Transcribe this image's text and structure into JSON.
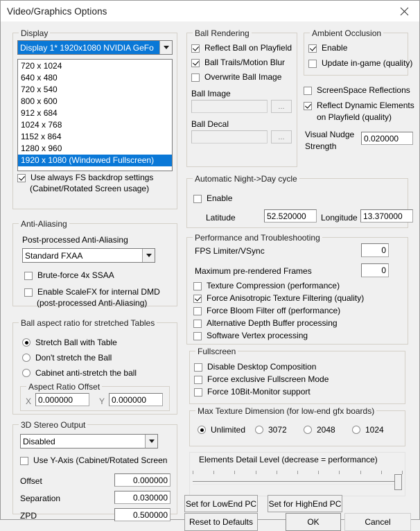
{
  "window": {
    "title": "Video/Graphics Options",
    "close_icon": "close-icon"
  },
  "display": {
    "caption": "Display",
    "combo_value": "Display 1* 1920x1080 NVIDIA GeFo",
    "resolutions": [
      "720 x 1024",
      "640 x 480",
      "720 x 540",
      "800 x 600",
      "912 x 684",
      "1024 x 768",
      "1152 x 864",
      "1280 x 960",
      "1920 x 1080 (Windowed Fullscreen)"
    ],
    "selected_resolution_index": 8,
    "fs_backdrop": {
      "label_line1": "Use always FS backdrop settings",
      "label_line2": "(Cabinet/Rotated Screen usage)",
      "checked": true
    }
  },
  "anti_aliasing": {
    "caption": "Anti-Aliasing",
    "post_label": "Post-processed Anti-Aliasing",
    "post_value": "Standard FXAA",
    "brute_force": {
      "label": "Brute-force 4x SSAA",
      "checked": false
    },
    "scalefx": {
      "label_line1": "Enable ScaleFX for internal DMD",
      "label_line2": "(post-processed Anti-Aliasing)",
      "checked": false
    }
  },
  "ball_aspect": {
    "caption": "Ball aspect ratio for stretched Tables",
    "options": [
      "Stretch Ball with Table",
      "Don't stretch the Ball",
      "Cabinet anti-stretch the ball"
    ],
    "selected_index": 0,
    "offset_caption": "Aspect Ratio Offset",
    "x_label": "X",
    "x_value": "0.000000",
    "y_label": "Y",
    "y_value": "0.000000"
  },
  "stereo": {
    "caption": "3D Stereo Output",
    "mode_value": "Disabled",
    "y_axis": {
      "label": "Use Y-Axis (Cabinet/Rotated Screen",
      "checked": false
    },
    "rows": [
      {
        "label": "Offset",
        "value": "0.000000"
      },
      {
        "label": "Separation",
        "value": "0.030000"
      },
      {
        "label": "ZPD",
        "value": "0.500000"
      }
    ]
  },
  "ball_rendering": {
    "caption": "Ball Rendering",
    "checks": [
      {
        "label": "Reflect Ball on Playfield",
        "checked": true
      },
      {
        "label": "Ball Trails/Motion Blur",
        "checked": true
      },
      {
        "label": "Overwrite Ball Image",
        "checked": false
      }
    ],
    "ball_image_label": "Ball Image",
    "ball_image_value": "",
    "ball_decal_label": "Ball Decal",
    "ball_decal_value": "",
    "browse_label": "..."
  },
  "ambient_occlusion": {
    "caption": "Ambient Occlusion",
    "enable": {
      "label": "Enable",
      "checked": true
    },
    "update": {
      "label": "Update in-game (quality)",
      "checked": false
    }
  },
  "reflections": {
    "screenspace": {
      "label": "ScreenSpace Reflections",
      "checked": false
    },
    "dynamic": {
      "label_line1": "Reflect Dynamic Elements",
      "label_line2": "on Playfield (quality)",
      "checked": true
    },
    "nudge_label_line1": "Visual Nudge",
    "nudge_label_line2": "Strength",
    "nudge_value": "0.020000"
  },
  "night_day": {
    "caption": "Automatic Night->Day cycle",
    "enable": {
      "label": "Enable",
      "checked": false
    },
    "latitude_label": "Latitude",
    "latitude_value": "52.520000",
    "longitude_label": "Longitude",
    "longitude_value": "13.370000"
  },
  "performance": {
    "caption": "Performance and Troubleshooting",
    "fps_label": "FPS Limiter/VSync",
    "fps_value": "0",
    "prerendered_label": "Maximum pre-rendered Frames",
    "prerendered_value": "0",
    "checks": [
      {
        "label": "Texture Compression (performance)",
        "checked": false
      },
      {
        "label": "Force Anisotropic Texture Filtering (quality)",
        "checked": true
      },
      {
        "label": "Force Bloom Filter off (performance)",
        "checked": false
      },
      {
        "label": "Alternative Depth Buffer processing",
        "checked": false
      },
      {
        "label": "Software Vertex processing",
        "checked": false
      }
    ]
  },
  "fullscreen": {
    "caption": "Fullscreen",
    "checks": [
      {
        "label": "Disable Desktop Composition",
        "checked": false
      },
      {
        "label": "Force exclusive Fullscreen Mode",
        "checked": false
      },
      {
        "label": "Force 10Bit-Monitor support",
        "checked": false
      }
    ]
  },
  "max_texture": {
    "caption": "Max Texture Dimension (for low-end gfx boards)",
    "options": [
      "Unlimited",
      "3072",
      "2048",
      "1024"
    ],
    "selected_index": 0
  },
  "detail": {
    "label": "Elements Detail Level (decrease = performance)",
    "tick_count": 11,
    "thumb_position_percent": 100
  },
  "buttons": {
    "low_end": "Set for LowEnd PC",
    "high_end": "Set for HighEnd PC",
    "reset": "Reset to Defaults",
    "ok": "OK",
    "cancel": "Cancel"
  }
}
